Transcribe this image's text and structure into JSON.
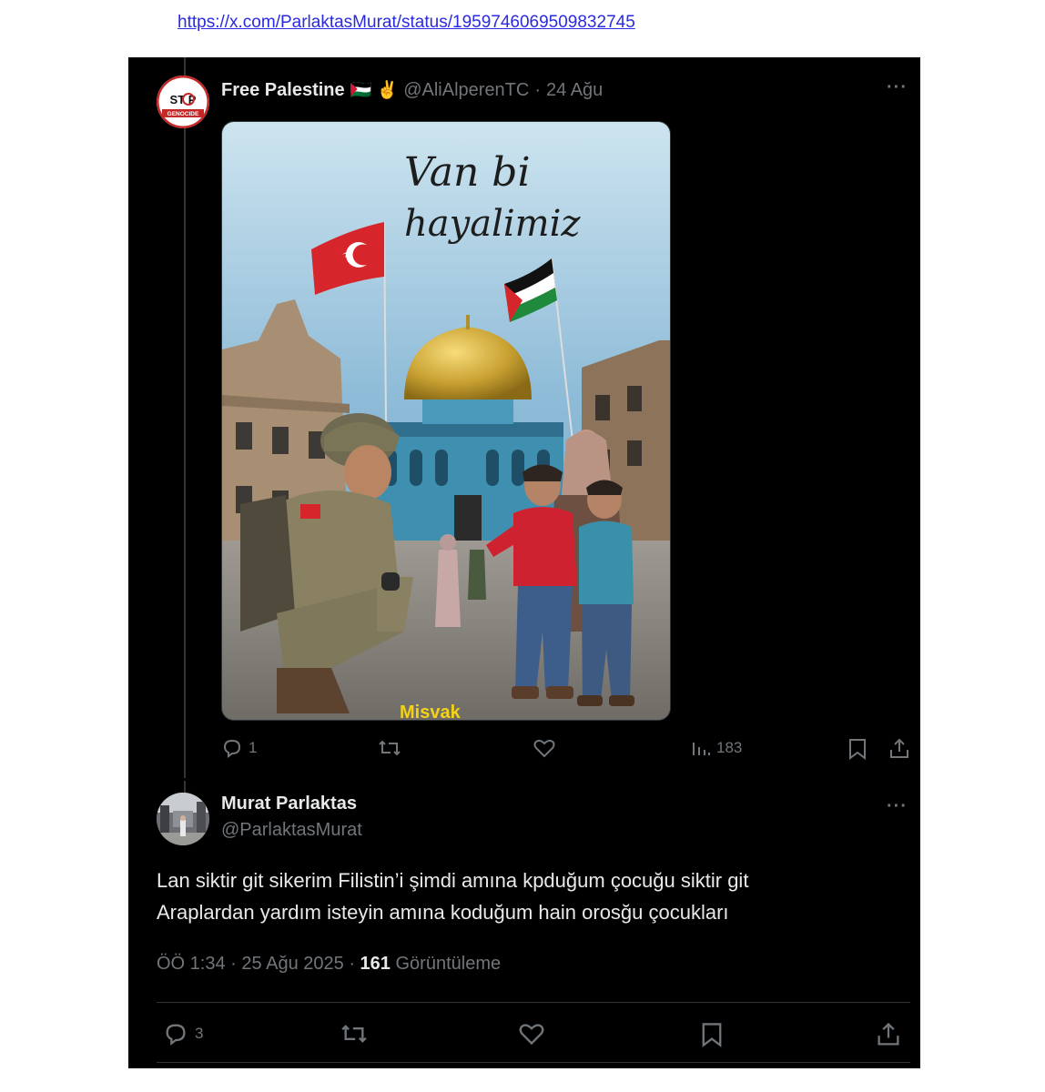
{
  "source_url": "https://x.com/ParlaktasMurat/status/1959746069509832745",
  "quoted_post": {
    "display_name": "Free Palestine",
    "emoji": "🇵🇸 ✌️",
    "handle": "@AliAlperenTC",
    "separator": "·",
    "date": "24 Ağu",
    "more": "···",
    "avatar_text_top": "ST P",
    "avatar_text_bottom": "GENOCIDE",
    "image_caption_line1": "Van bi",
    "image_caption_line2": "hayalimiz",
    "image_watermark": "Misvak",
    "stats": {
      "replies": "1",
      "views": "183"
    }
  },
  "reply_post": {
    "display_name": "Murat Parlaktas",
    "handle": "@ParlaktasMurat",
    "more": "···",
    "text_line1": "Lan siktir git sikerim Filistin’i şimdi amına kpduğum çocuğu  siktir git",
    "text_line2": "Araplardan yardım isteyin  amına koduğum hain orosğu çocukları",
    "time": "ÖÖ 1:34",
    "dot": "·",
    "date": "25 Ağu 2025",
    "dot2": "·",
    "views_count": "161",
    "views_label": "Görüntüleme",
    "stats": {
      "replies": "3"
    }
  },
  "colors": {
    "background": "#000000",
    "text": "#e7e9ea",
    "muted": "#71767b",
    "link": "#2a2ae0"
  },
  "icons": [
    "reply-icon",
    "retweet-icon",
    "like-icon",
    "views-icon",
    "bookmark-icon",
    "share-icon"
  ]
}
